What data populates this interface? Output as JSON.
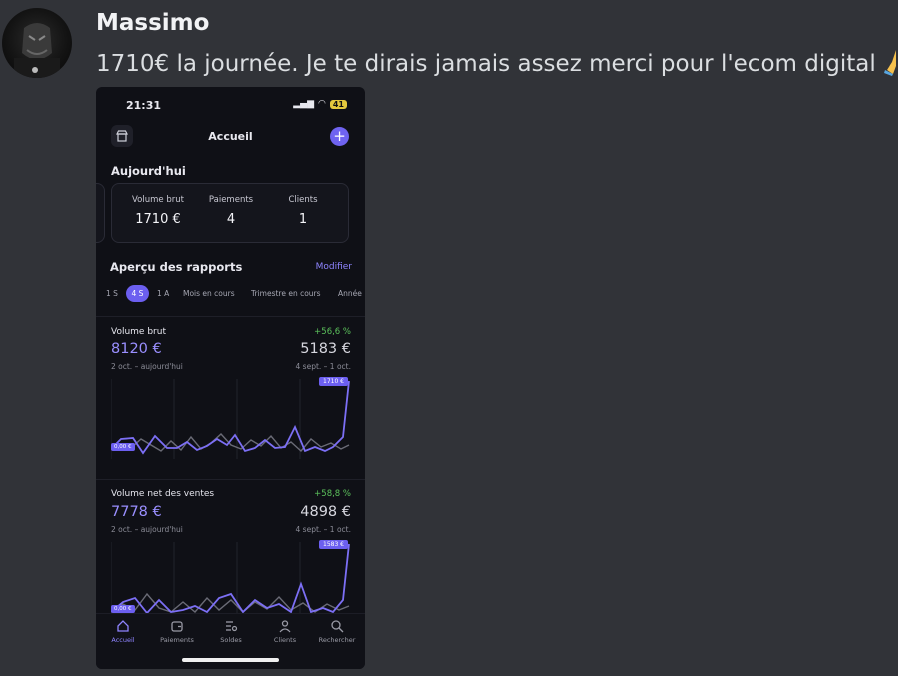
{
  "message": {
    "author": "Massimo",
    "text": "1710€ la journée. Je te dirais jamais assez merci pour l'ecom digital",
    "emoji": "folded-hands-emoji"
  },
  "phone": {
    "status": {
      "time": "21:31",
      "battery": "41"
    },
    "nav": {
      "title": "Accueil",
      "add_label": "+"
    },
    "today": {
      "title": "Aujourd'hui",
      "stats": [
        {
          "label": "Volume brut",
          "value": "1710 €"
        },
        {
          "label": "Paiements",
          "value": "4"
        },
        {
          "label": "Clients",
          "value": "1"
        }
      ]
    },
    "reports": {
      "title": "Aperçu des rapports",
      "modify": "Modifier",
      "tabs": [
        "1 S",
        "4 S",
        "1 A",
        "Mois en cours",
        "Trimestre en cours",
        "Année"
      ],
      "active_tab": "4 S"
    },
    "metrics": [
      {
        "name": "Volume brut",
        "growth": "+56,6 %",
        "value": "8120 €",
        "prev_value": "5183 €",
        "period": "2 oct. – aujourd'hui",
        "prev_period": "4 sept. – 1 oct.",
        "max_label": "1710 €",
        "min_label": "0,00 €"
      },
      {
        "name": "Volume net des ventes",
        "growth": "+58,8 %",
        "value": "7778 €",
        "prev_value": "4898 €",
        "period": "2 oct. – aujourd'hui",
        "prev_period": "4 sept. – 1 oct.",
        "max_label": "1583 €",
        "min_label": "0,00 €"
      }
    ],
    "tabbar": [
      {
        "label": "Accueil",
        "icon": "home-icon"
      },
      {
        "label": "Paiements",
        "icon": "wallet-icon"
      },
      {
        "label": "Soldes",
        "icon": "balances-icon"
      },
      {
        "label": "Clients",
        "icon": "person-icon"
      },
      {
        "label": "Rechercher",
        "icon": "search-icon"
      }
    ],
    "colors": {
      "accent": "#6c5ff0",
      "positive": "#5cc25c",
      "background": "#0f1016"
    }
  }
}
